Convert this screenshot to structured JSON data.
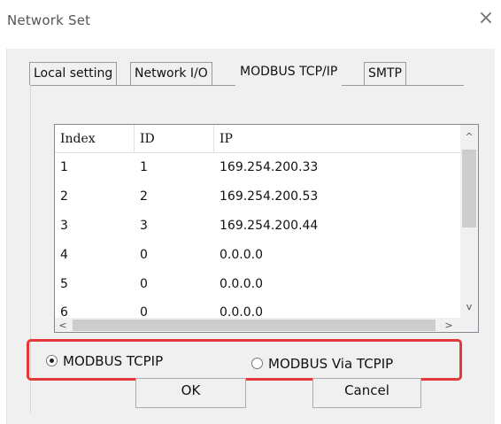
{
  "window": {
    "title": "Network Set",
    "close_glyph": "×"
  },
  "tabs": [
    {
      "label": "Local setting",
      "active": false
    },
    {
      "label": "Network I/O",
      "active": false
    },
    {
      "label": "MODBUS TCP/IP",
      "active": true
    },
    {
      "label": "SMTP",
      "active": false
    }
  ],
  "table": {
    "columns": [
      "Index",
      "ID",
      "IP"
    ],
    "rows": [
      [
        "1",
        "1",
        "169.254.200.33"
      ],
      [
        "2",
        "2",
        "169.254.200.53"
      ],
      [
        "3",
        "3",
        "169.254.200.44"
      ],
      [
        "4",
        "0",
        "0.0.0.0"
      ],
      [
        "5",
        "0",
        "0.0.0.0"
      ],
      [
        "6",
        "0",
        "0.0.0.0"
      ]
    ],
    "scroll_up_glyph": "^",
    "scroll_down_glyph": "v",
    "scroll_left_glyph": "<",
    "scroll_right_glyph": ">"
  },
  "mode": {
    "options": [
      {
        "label": "MODBUS TCPIP",
        "selected": true
      },
      {
        "label": "MODBUS Via TCPIP",
        "selected": false
      }
    ],
    "highlight_color": "#e3383c"
  },
  "buttons": {
    "ok_label": "OK",
    "cancel_label": "Cancel"
  },
  "icons": {
    "close": "close-icon",
    "radio_checked": "radio-checked-icon",
    "radio_unchecked": "radio-unchecked-icon"
  }
}
